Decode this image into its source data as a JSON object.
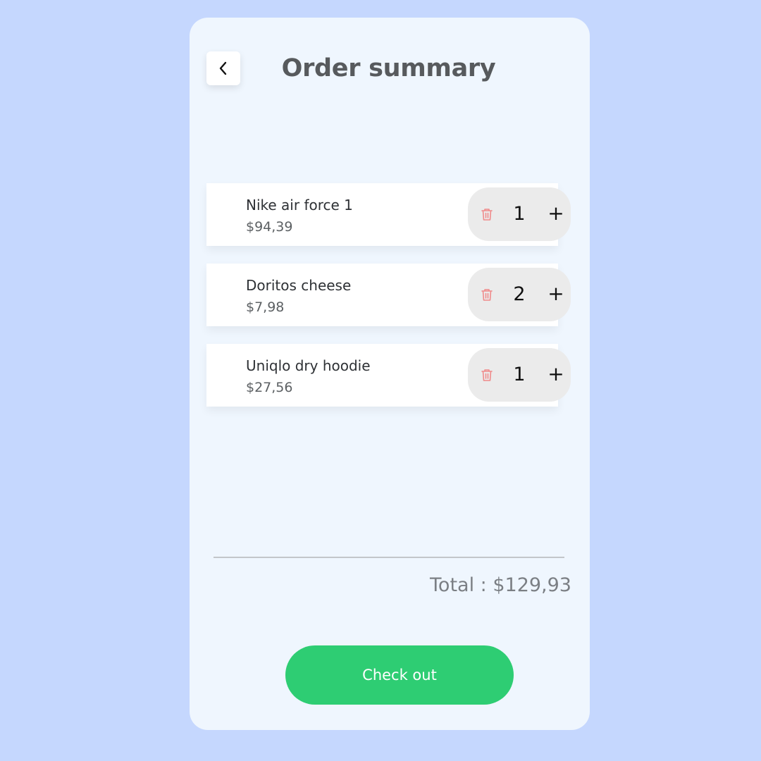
{
  "header": {
    "title": "Order summary",
    "back_icon": "chevron-left-icon"
  },
  "items": [
    {
      "name": "Nike air force 1",
      "price": "$94,39",
      "quantity": "1"
    },
    {
      "name": "Doritos cheese",
      "price": "$7,98",
      "quantity": "2"
    },
    {
      "name": "Uniqlo dry hoodie",
      "price": "$27,56",
      "quantity": "1"
    }
  ],
  "stepper": {
    "remove_icon": "trash-icon",
    "add_label": "+"
  },
  "summary": {
    "total": "Total : $129,93"
  },
  "checkout": {
    "label": "Check out"
  },
  "colors": {
    "background": "#c5d7fe",
    "card": "#eff6fe",
    "accent": "#2ecd73",
    "trash": "#f08a8a"
  }
}
